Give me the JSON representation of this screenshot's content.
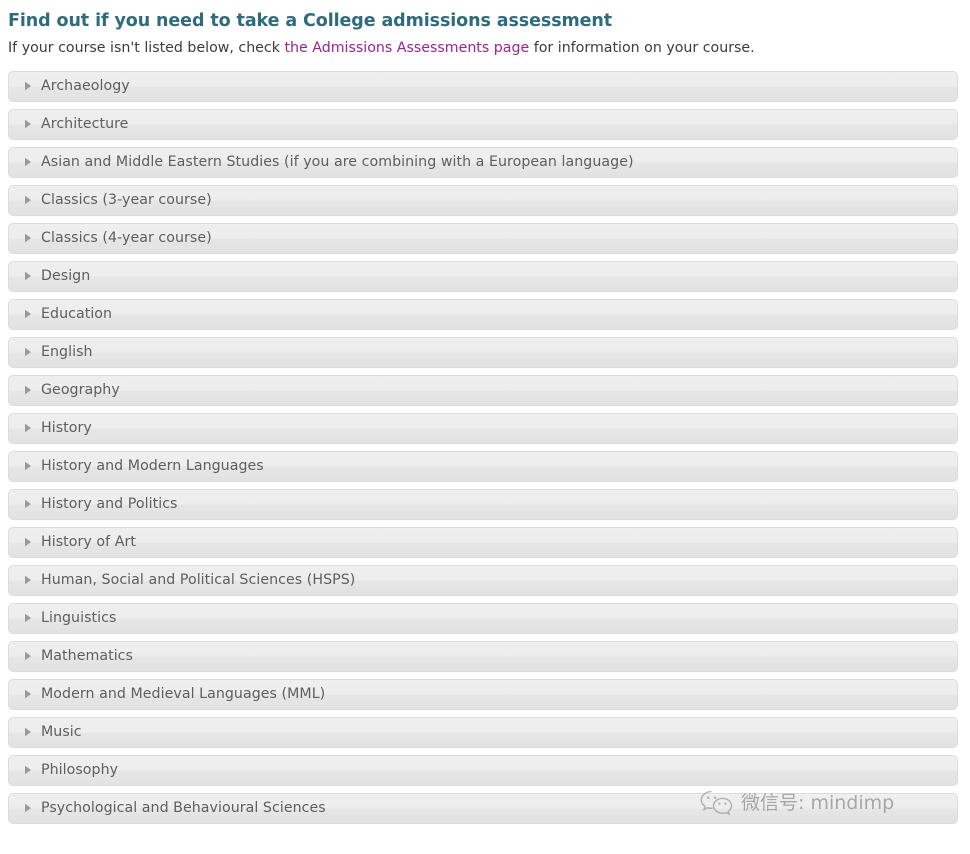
{
  "page": {
    "title": "Find out if you need to take a College admissions assessment",
    "intro": {
      "before_link": "If your course isn't listed below, check ",
      "link_text": "the Admissions Assessments page",
      "after_link": " for information on your course."
    },
    "link_color": "#9b258f",
    "title_color": "#2e6c7d"
  },
  "accordion": {
    "arrow_icon": "triangle-right-icon",
    "items": [
      {
        "label": "Archaeology"
      },
      {
        "label": "Architecture"
      },
      {
        "label": "Asian and Middle Eastern Studies (if you are combining with a European language)"
      },
      {
        "label": "Classics (3-year course)"
      },
      {
        "label": "Classics (4-year course)"
      },
      {
        "label": "Design"
      },
      {
        "label": "Education"
      },
      {
        "label": "English"
      },
      {
        "label": "Geography"
      },
      {
        "label": "History"
      },
      {
        "label": "History and Modern Languages"
      },
      {
        "label": "History and Politics"
      },
      {
        "label": "History of Art"
      },
      {
        "label": "Human, Social and Political Sciences (HSPS)"
      },
      {
        "label": "Linguistics"
      },
      {
        "label": "Mathematics"
      },
      {
        "label": "Modern and Medieval Languages (MML)"
      },
      {
        "label": "Music"
      },
      {
        "label": "Philosophy"
      },
      {
        "label": "Psychological and Behavioural Sciences"
      }
    ]
  },
  "watermark": {
    "icon": "wechat-logo-icon",
    "text": "微信号: mindimp"
  }
}
